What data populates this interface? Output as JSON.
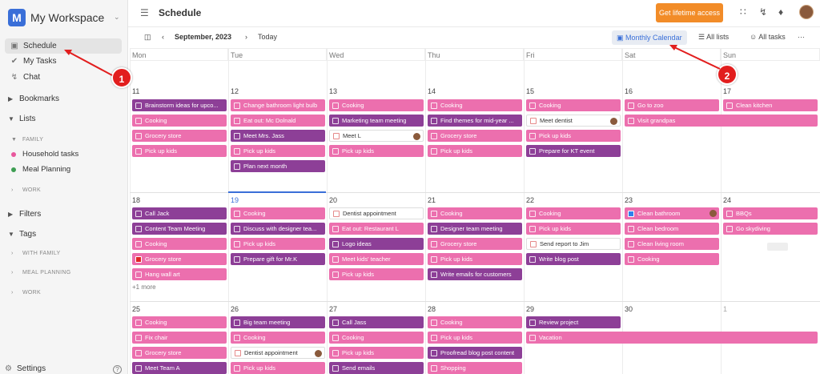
{
  "sidebar": {
    "logo_letter": "M",
    "workspace_name": "My Workspace",
    "nav": [
      {
        "label": "Schedule",
        "icon": "calendar-icon"
      },
      {
        "label": "My Tasks",
        "icon": "check-circle-icon"
      },
      {
        "label": "Chat",
        "icon": "lightning-icon"
      }
    ],
    "bookmarks_label": "Bookmarks",
    "lists_label": "Lists",
    "family_label": "FAMILY",
    "family_lists": [
      {
        "label": "Household tasks",
        "color": "#e8579c"
      },
      {
        "label": "Meal Planning",
        "color": "#3d9e52"
      }
    ],
    "work_label": "WORK",
    "filters_label": "Filters",
    "tags_label": "Tags",
    "tag_groups": [
      "WITH FAMILY",
      "MEAL PLANNING",
      "WORK"
    ],
    "settings_label": "Settings",
    "help_label": "?"
  },
  "topbar": {
    "title": "Schedule",
    "lifetime_button": "Get lifetime access"
  },
  "toolbar": {
    "month_label": "September, 2023",
    "today_label": "Today",
    "monthly_calendar_label": "Monthly Calendar",
    "all_lists_label": "All lists",
    "all_tasks_label": "All tasks",
    "more_label": "···"
  },
  "calendar": {
    "weekdays": [
      "Mon",
      "Tue",
      "Wed",
      "Thu",
      "Fri",
      "Sat",
      "Sun"
    ],
    "weeks": [
      {
        "days": [
          "11",
          "12",
          "13",
          "14",
          "15",
          "16",
          "17"
        ],
        "events": [
          {
            "day": 0,
            "row": 0,
            "span": 1,
            "label": "Brainstorm ideas for upco...",
            "style": "u"
          },
          {
            "day": 0,
            "row": 1,
            "span": 1,
            "label": "Cooking",
            "style": "p"
          },
          {
            "day": 0,
            "row": 2,
            "span": 1,
            "label": "Grocery store",
            "style": "p"
          },
          {
            "day": 0,
            "row": 3,
            "span": 1,
            "label": "Pick up kids",
            "style": "p"
          },
          {
            "day": 1,
            "row": 0,
            "span": 1,
            "label": "Change bathroom light bulb",
            "style": "p"
          },
          {
            "day": 1,
            "row": 1,
            "span": 1,
            "label": "Eat out: Mc Dolnald",
            "style": "p"
          },
          {
            "day": 1,
            "row": 2,
            "span": 1,
            "label": "Meet Mrs. Jass",
            "style": "u"
          },
          {
            "day": 1,
            "row": 3,
            "span": 1,
            "label": "Pick up kids",
            "style": "p"
          },
          {
            "day": 1,
            "row": 4,
            "span": 1,
            "label": "Plan next month",
            "style": "u"
          },
          {
            "day": 2,
            "row": 0,
            "span": 1,
            "label": "Cooking",
            "style": "p"
          },
          {
            "day": 2,
            "row": 1,
            "span": 1,
            "label": "Marketing team meeting",
            "style": "u"
          },
          {
            "day": 2,
            "row": 2,
            "span": 1,
            "label": "Meet L",
            "style": "w",
            "avatar": true
          },
          {
            "day": 2,
            "row": 3,
            "span": 1,
            "label": "Pick up kids",
            "style": "p"
          },
          {
            "day": 3,
            "row": 0,
            "span": 1,
            "label": "Cooking",
            "style": "p"
          },
          {
            "day": 3,
            "row": 1,
            "span": 1,
            "label": "Find themes for mid-year ...",
            "style": "u"
          },
          {
            "day": 3,
            "row": 2,
            "span": 1,
            "label": "Grocery store",
            "style": "p"
          },
          {
            "day": 3,
            "row": 3,
            "span": 1,
            "label": "Pick up kids",
            "style": "p"
          },
          {
            "day": 4,
            "row": 0,
            "span": 1,
            "label": "Cooking",
            "style": "p"
          },
          {
            "day": 4,
            "row": 1,
            "span": 1,
            "label": "Meet dentist",
            "style": "w",
            "avatar": true
          },
          {
            "day": 4,
            "row": 2,
            "span": 1,
            "label": "Pick up kids",
            "style": "p"
          },
          {
            "day": 4,
            "row": 3,
            "span": 1,
            "label": "Prepare for KT event",
            "style": "u"
          },
          {
            "day": 5,
            "row": 0,
            "span": 1,
            "label": "Go to zoo",
            "style": "p"
          },
          {
            "day": 5,
            "row": 1,
            "span": 2,
            "label": "Visit grandpas",
            "style": "p"
          },
          {
            "day": 6,
            "row": 0,
            "span": 1,
            "label": "Clean kitchen",
            "style": "p"
          }
        ]
      },
      {
        "days": [
          "18",
          "19",
          "20",
          "21",
          "22",
          "23",
          "24"
        ],
        "events": [
          {
            "day": 0,
            "row": 0,
            "span": 1,
            "label": "Call Jack",
            "style": "u"
          },
          {
            "day": 0,
            "row": 1,
            "span": 1,
            "label": "Content Team Meeting",
            "style": "u"
          },
          {
            "day": 0,
            "row": 2,
            "span": 1,
            "label": "Cooking",
            "style": "p"
          },
          {
            "day": 0,
            "row": 3,
            "span": 1,
            "label": "Grocery store",
            "style": "p",
            "red": true
          },
          {
            "day": 0,
            "row": 4,
            "span": 1,
            "label": "Hang wall art",
            "style": "p"
          },
          {
            "day": 1,
            "row": 0,
            "span": 1,
            "label": "Cooking",
            "style": "p"
          },
          {
            "day": 1,
            "row": 1,
            "span": 1,
            "label": "Discuss with designer tea...",
            "style": "u"
          },
          {
            "day": 1,
            "row": 2,
            "span": 1,
            "label": "Pick up kids",
            "style": "p"
          },
          {
            "day": 1,
            "row": 3,
            "span": 1,
            "label": "Prepare gift for Mr.K",
            "style": "u"
          },
          {
            "day": 2,
            "row": 0,
            "span": 1,
            "label": "Dentist appointment",
            "style": "w"
          },
          {
            "day": 2,
            "row": 1,
            "span": 1,
            "label": "Eat out: Restaurant L",
            "style": "p"
          },
          {
            "day": 2,
            "row": 2,
            "span": 1,
            "label": "Logo ideas",
            "style": "u"
          },
          {
            "day": 2,
            "row": 3,
            "span": 1,
            "label": "Meet kids' teacher",
            "style": "p"
          },
          {
            "day": 2,
            "row": 4,
            "span": 1,
            "label": "Pick up kids",
            "style": "p"
          },
          {
            "day": 3,
            "row": 0,
            "span": 1,
            "label": "Cooking",
            "style": "p"
          },
          {
            "day": 3,
            "row": 1,
            "span": 1,
            "label": "Designer team meeting",
            "style": "u"
          },
          {
            "day": 3,
            "row": 2,
            "span": 1,
            "label": "Grocery store",
            "style": "p"
          },
          {
            "day": 3,
            "row": 3,
            "span": 1,
            "label": "Pick up kids",
            "style": "p"
          },
          {
            "day": 3,
            "row": 4,
            "span": 1,
            "label": "Write emails for customers",
            "style": "u"
          },
          {
            "day": 4,
            "row": 0,
            "span": 1,
            "label": "Cooking",
            "style": "p"
          },
          {
            "day": 4,
            "row": 1,
            "span": 1,
            "label": "Pick up kids",
            "style": "p"
          },
          {
            "day": 4,
            "row": 2,
            "span": 1,
            "label": "Send report to Jim",
            "style": "w"
          },
          {
            "day": 4,
            "row": 3,
            "span": 1,
            "label": "Write blog post",
            "style": "u"
          },
          {
            "day": 5,
            "row": 0,
            "span": 1,
            "label": "Clean bathroom",
            "style": "p",
            "blue": true,
            "avatar": true
          },
          {
            "day": 5,
            "row": 1,
            "span": 1,
            "label": "Clean bedroom",
            "style": "p"
          },
          {
            "day": 5,
            "row": 2,
            "span": 1,
            "label": "Clean living room",
            "style": "p"
          },
          {
            "day": 5,
            "row": 3,
            "span": 1,
            "label": "Cooking",
            "style": "p"
          },
          {
            "day": 6,
            "row": 0,
            "span": 1,
            "label": "BBQs",
            "style": "p"
          },
          {
            "day": 6,
            "row": 1,
            "span": 1,
            "label": "Go skydiving",
            "style": "p"
          }
        ],
        "more_label": "+1 more"
      },
      {
        "days": [
          "25",
          "26",
          "27",
          "28",
          "29",
          "30",
          "1"
        ],
        "events": [
          {
            "day": 0,
            "row": 0,
            "span": 1,
            "label": "Cooking",
            "style": "p"
          },
          {
            "day": 0,
            "row": 1,
            "span": 1,
            "label": "Fix chair",
            "style": "p"
          },
          {
            "day": 0,
            "row": 2,
            "span": 1,
            "label": "Grocery store",
            "style": "p"
          },
          {
            "day": 0,
            "row": 3,
            "span": 1,
            "label": "Meet Team A",
            "style": "u"
          },
          {
            "day": 1,
            "row": 0,
            "span": 1,
            "label": "Big team meeting",
            "style": "u"
          },
          {
            "day": 1,
            "row": 1,
            "span": 1,
            "label": "Cooking",
            "style": "p"
          },
          {
            "day": 1,
            "row": 2,
            "span": 1,
            "label": "Dentist appointment",
            "style": "w",
            "avatar": true
          },
          {
            "day": 1,
            "row": 3,
            "span": 1,
            "label": "Pick up kids",
            "style": "p"
          },
          {
            "day": 2,
            "row": 0,
            "span": 1,
            "label": "Call Jass",
            "style": "u"
          },
          {
            "day": 2,
            "row": 1,
            "span": 1,
            "label": "Cooking",
            "style": "p"
          },
          {
            "day": 2,
            "row": 2,
            "span": 1,
            "label": "Pick up kids",
            "style": "p"
          },
          {
            "day": 2,
            "row": 3,
            "span": 1,
            "label": "Send emails",
            "style": "u"
          },
          {
            "day": 3,
            "row": 0,
            "span": 1,
            "label": "Cooking",
            "style": "p"
          },
          {
            "day": 3,
            "row": 1,
            "span": 1,
            "label": "Pick up kids",
            "style": "p"
          },
          {
            "day": 3,
            "row": 2,
            "span": 1,
            "label": "Proofread blog post content",
            "style": "u"
          },
          {
            "day": 3,
            "row": 3,
            "span": 1,
            "label": "Shopping",
            "style": "p"
          },
          {
            "day": 4,
            "row": 0,
            "span": 1,
            "label": "Review project",
            "style": "u"
          },
          {
            "day": 4,
            "row": 1,
            "span": 3,
            "label": "Vacation",
            "style": "p"
          }
        ]
      }
    ]
  },
  "annotations": [
    "1",
    "2"
  ]
}
